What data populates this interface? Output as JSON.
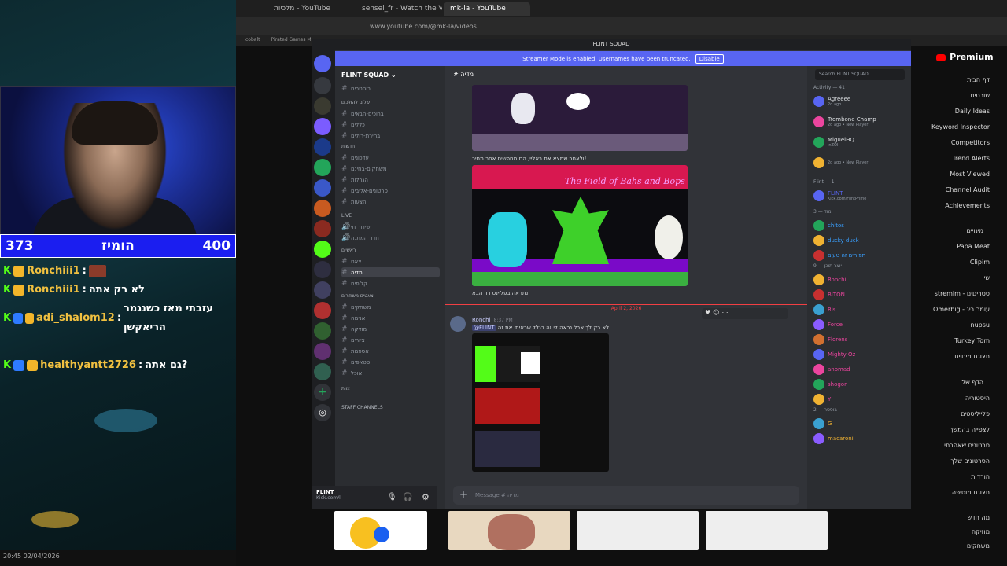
{
  "stream": {
    "score_left": "373",
    "score_center": "הומיז",
    "score_right": "400",
    "chat": [
      {
        "user": "Ronchiii1",
        "message": ""
      },
      {
        "user": "Ronchiii1",
        "message": "לא רק אתה"
      },
      {
        "user": "adi_shalom12",
        "message": "עזבתי מאז כשנגמר הריאקשן"
      },
      {
        "user": "healthyantt2726",
        "message": "גם אתה?"
      }
    ],
    "taskbar_time": "20:45",
    "taskbar_date": "02/04/2026"
  },
  "browser": {
    "tabs": [
      "מלכיות - YouTube",
      "sensei_fr - Watch the VOD on K",
      "mk-la - YouTube"
    ],
    "url": "www.youtube.com/@mk-la/videos",
    "bookmarks": [
      "cobalt",
      "Pirated Games M"
    ]
  },
  "discord": {
    "window_title": "FLINT SQUAD",
    "banner_text": "Streamer Mode is enabled. Usernames have been truncated.",
    "banner_button": "Disable",
    "server_name": "FLINT SQUAD",
    "channel_header": "מדיה",
    "search_placeholder": "Search FLINT SQUAD",
    "channels": [
      {
        "label": "בוסטרים",
        "type": "text"
      },
      {
        "label": "שלום להולכים",
        "type": "category"
      },
      {
        "label": "ברוכים-הבאים",
        "type": "text"
      },
      {
        "label": "כללים",
        "type": "text"
      },
      {
        "label": "בחירת-רולים",
        "type": "text"
      },
      {
        "label": "חדשות",
        "type": "category"
      },
      {
        "label": "עדכונים",
        "type": "text"
      },
      {
        "label": "משחקים-בחינם",
        "type": "text"
      },
      {
        "label": "הגרלות",
        "type": "text"
      },
      {
        "label": "סרטונים-אליבים",
        "type": "text"
      },
      {
        "label": "הצעות",
        "type": "text"
      },
      {
        "label": "LIVE",
        "type": "category"
      },
      {
        "label": "שידור חי",
        "type": "voice"
      },
      {
        "label": "חדר המתנה",
        "type": "voice"
      },
      {
        "label": "ראשיים",
        "type": "category"
      },
      {
        "label": "צאט",
        "type": "text"
      },
      {
        "label": "מדיה",
        "type": "text",
        "selected": true
      },
      {
        "label": "קליפים",
        "type": "text"
      },
      {
        "label": "צאטים משודרים",
        "type": "category"
      },
      {
        "label": "משחקים",
        "type": "text"
      },
      {
        "label": "אנימה",
        "type": "text"
      },
      {
        "label": "מוזיקה",
        "type": "text"
      },
      {
        "label": "ציורים",
        "type": "text"
      },
      {
        "label": "אספנות",
        "type": "text"
      },
      {
        "label": "סטאפים",
        "type": "text"
      },
      {
        "label": "אוכל",
        "type": "text"
      },
      {
        "label": "צוות",
        "type": "category"
      },
      {
        "label": "STAFF CHANNELS",
        "type": "category"
      }
    ],
    "user_panel": {
      "name": "FLINT",
      "sub": "Kick.com/l"
    },
    "image_caption_1": "ולאחר שמצא את ראליי, הם מחפשים אחר מחיר!",
    "image_title": "The Field of Bahs and Bops",
    "image_caption_2": "נתראה בפליינט רון הבא",
    "date_divider": "April 2, 2026",
    "message": {
      "author": "Ronchi",
      "time": "8:37 PM",
      "mention": "@FLINT",
      "text": "לא רק לך אבל נראה לי זה בגלל שראיתי את זה"
    },
    "message_input_placeholder": "Message # מדיה",
    "members": {
      "activity_header": "Activity — 41",
      "activity": [
        {
          "name": "Agreeee",
          "sub": "2d ago"
        },
        {
          "name": "Trombone Champ",
          "sub": "2d ago • New Player"
        },
        {
          "name": "MiguelHQ",
          "sub": "inZOI"
        },
        {
          "name": "",
          "sub": "2d ago • New Player"
        }
      ],
      "flint_header": "Flint — 1",
      "flint": [
        {
          "name": "FLINT",
          "sub": "Kick.com/FlintPrime"
        }
      ],
      "mod_header": "מוד — 3",
      "mods": [
        {
          "name": "chitos"
        },
        {
          "name": "ducky duck"
        },
        {
          "name": "תפוחים זה טעים"
        }
      ],
      "regular_header": "יוצר תוכן — 9",
      "regulars": [
        {
          "name": "Ronchi"
        },
        {
          "name": "BITON"
        },
        {
          "name": "Ris"
        },
        {
          "name": "Force"
        },
        {
          "name": "Florens"
        },
        {
          "name": "Mighty Oz"
        },
        {
          "name": "anomad"
        },
        {
          "name": "shogon"
        },
        {
          "name": "Y"
        }
      ],
      "boost_header": "בוסטר — 2",
      "boosters": [
        {
          "name": "G"
        },
        {
          "name": "macaroni"
        }
      ]
    }
  },
  "youtube": {
    "premium_label": "Premium",
    "sidebar": [
      "דף הבית",
      "שורטים",
      "Daily Ideas",
      "Keyword Inspector",
      "Competitors",
      "Trend Alerts",
      "Most Viewed",
      "Channel Audit",
      "Achievements"
    ],
    "subs_header": "מינויים",
    "subs": [
      "Papa Meat",
      "Clipim",
      "שי",
      "stremim - סטריםים",
      "Omerbig - עומר ביג",
      "nupsu",
      "Turkey Tom",
      "תצוגת מינויים"
    ],
    "you_header": "הדף שלי",
    "you": [
      "היסטוריה",
      "פלייליסטים",
      "לצפייה בהמשך",
      "סרטונים שאהבתי",
      "הסרטונים שלך",
      "הורדות",
      "תצוגת מוסיפה"
    ],
    "explore": [
      "מה חדש",
      "מוזיקה",
      "משחקים"
    ]
  },
  "colors": {
    "discord_blurple": "#5865f2",
    "kick_green": "#53fc18",
    "score_blue": "#1b1ef0",
    "yt_red": "#ff0000"
  }
}
